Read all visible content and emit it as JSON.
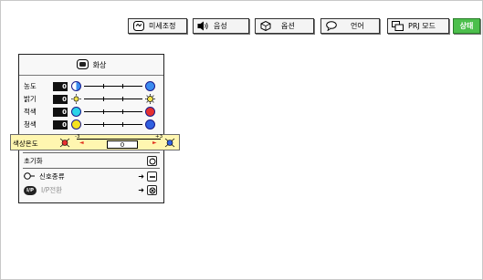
{
  "menu": {
    "tabs": [
      {
        "label": "미세조정",
        "icon": "fine-sync-icon"
      },
      {
        "label": "음성",
        "icon": "speaker-icon"
      },
      {
        "label": "옵션",
        "icon": "options-icon"
      },
      {
        "label": "언어",
        "icon": "speech-bubble-icon"
      },
      {
        "label": "PRJ 모드",
        "icon": "projector-mode-icon"
      },
      {
        "label": "상태",
        "icon": ""
      }
    ],
    "speaker_note": "(·",
    "active_tab": "상태"
  },
  "panel": {
    "title": "화상",
    "title_icon": "picture-icon",
    "rows": [
      {
        "label": "농도",
        "value": "0",
        "left_icon": "circle-half-icon",
        "right_icon": "circle-full-icon",
        "left_color": "#ffffff",
        "right_color": "#3b8cf0"
      },
      {
        "label": "밝기",
        "value": "0",
        "left_icon": "sun-dim-icon",
        "right_icon": "sun-bright-icon",
        "left_color": "#f2e24a",
        "right_color": "#f2e24a"
      },
      {
        "label": "적색",
        "value": "0",
        "left_icon": "cyan-circle-icon",
        "right_icon": "red-circle-icon",
        "left_color": "#2bd4e8",
        "right_color": "#e53030"
      },
      {
        "label": "청색",
        "value": "0",
        "left_icon": "yellow-circle-icon",
        "right_icon": "blue-circle-icon",
        "left_color": "#f5e21e",
        "right_color": "#3060e0"
      }
    ],
    "selected": {
      "label": "색상온도",
      "value": "0",
      "min_label": "-3",
      "max_label": "+3",
      "left_arrow": "◄",
      "right_arrow": "►"
    },
    "reset": {
      "label": "초기화",
      "icon": "reset-icon"
    },
    "signal": {
      "label": "신호종류",
      "icon": "signal-plug-icon",
      "arrow": "➜"
    },
    "ip": {
      "label": "I/P전환",
      "icon": "ip-badge-icon",
      "badge": "I/P",
      "arrow": "➜"
    }
  },
  "colors": {
    "tab_active_bg": "#4cbf4c",
    "highlight_bg": "#fff6b0",
    "value_box": "#111111",
    "arrow_red": "#e0301e"
  }
}
